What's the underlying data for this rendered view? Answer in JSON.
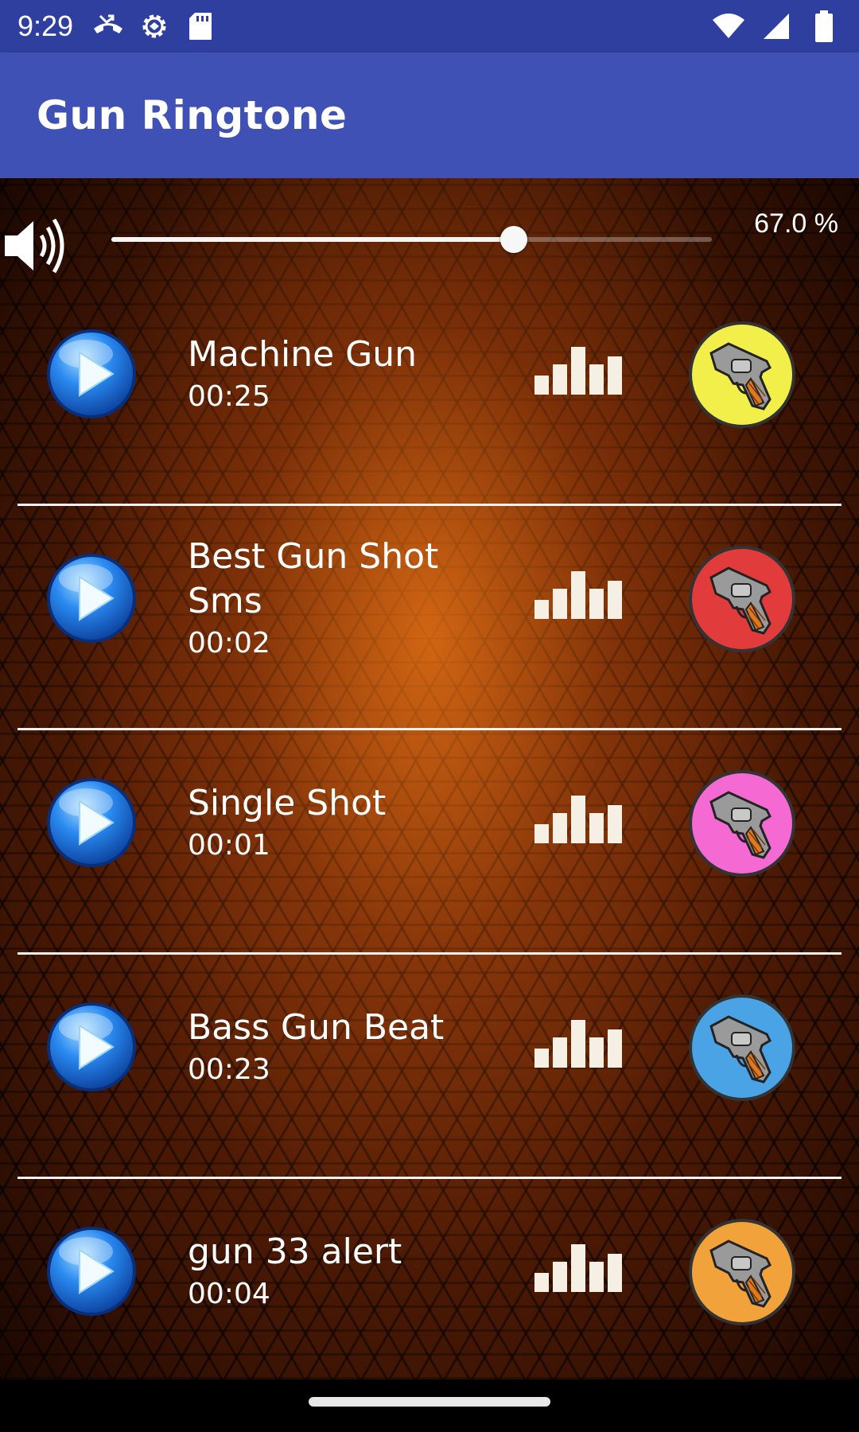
{
  "status_bar": {
    "time": "9:29",
    "left_icons": [
      "missed-call-icon",
      "settings-gear-icon",
      "sd-card-icon"
    ],
    "right_icons": [
      "wifi-icon",
      "cell-signal-icon",
      "battery-icon"
    ]
  },
  "app_bar": {
    "title": "Gun Ringtone",
    "color": "#3f51b5"
  },
  "volume": {
    "percent_label": "67.0 %",
    "level": 0.67
  },
  "songs": [
    {
      "title": "Machine Gun",
      "duration": "00:25",
      "badge_color": "#f2ef4a"
    },
    {
      "title": "Best Gun Shot Sms",
      "duration": "00:02",
      "badge_color": "#e23b3b"
    },
    {
      "title": "Single Shot",
      "duration": "00:01",
      "badge_color": "#f46ad2"
    },
    {
      "title": "Bass Gun Beat",
      "duration": "00:23",
      "badge_color": "#4aa3e4"
    },
    {
      "title": "gun 33 alert",
      "duration": "00:04",
      "badge_color": "#f2a23a"
    }
  ]
}
